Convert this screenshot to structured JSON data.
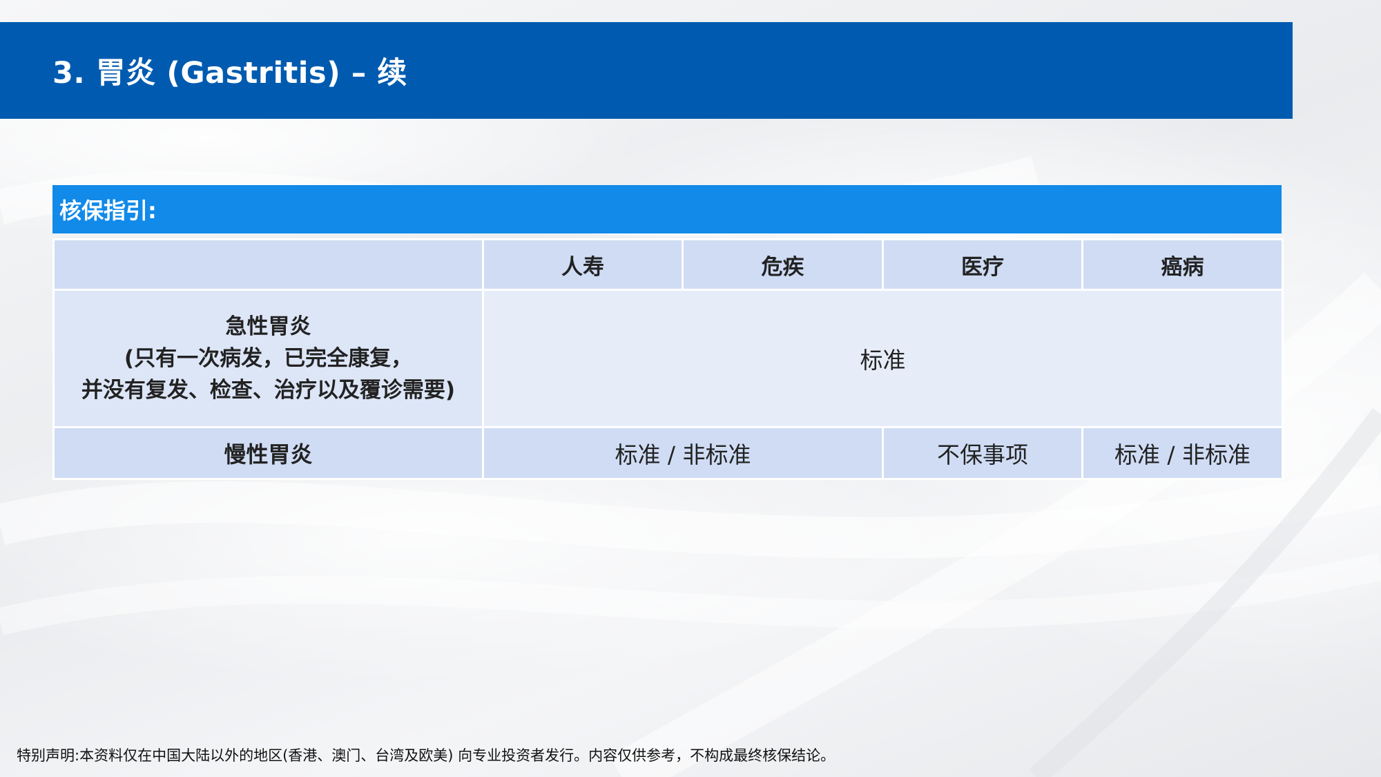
{
  "header": {
    "title": "3. 胃炎 (Gastritis) – 续"
  },
  "guide": {
    "title": "核保指引:"
  },
  "table": {
    "columns": [
      "",
      "人寿",
      "危疾",
      "医疗",
      "癌病"
    ],
    "rows": [
      {
        "label_lines": [
          "急性胃炎",
          "(只有一次病发，已完全康复，",
          "并没有复发、检查、治疗以及覆诊需要)"
        ],
        "merged_value": "标准"
      },
      {
        "label": "慢性胃炎",
        "life_critical": "标准 / 非标准",
        "medical": "不保事项",
        "cancer": "标准 / 非标准"
      }
    ]
  },
  "footer": {
    "note": "特别声明:本资料仅在中国大陆以外的地区(香港、澳门、台湾及欧美) 向专业投资者发行。内容仅供参考，不构成最终核保结论。"
  },
  "colors": {
    "header_bar": "#005bb0",
    "guide_bar": "#118ae9",
    "table_header": "#cfdcf4",
    "table_light": "#e6edf9"
  }
}
